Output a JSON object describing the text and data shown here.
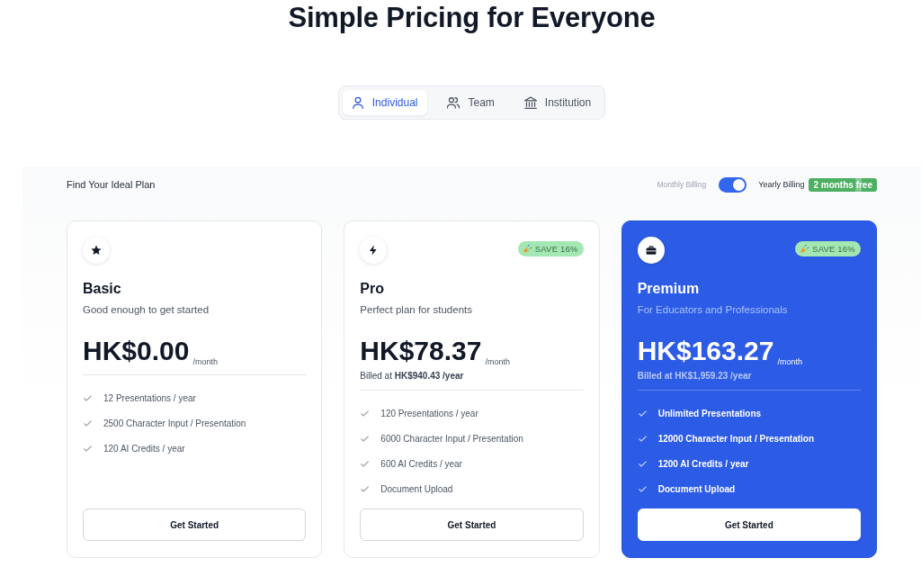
{
  "title": "Simple Pricing for Everyone",
  "audience_tabs": [
    {
      "label": "Individual",
      "selected": true
    },
    {
      "label": "Team",
      "selected": false
    },
    {
      "label": "Institution",
      "selected": false
    }
  ],
  "section_heading": "Find Your Ideal Plan",
  "billing": {
    "monthly_label": "Monthly Billing",
    "yearly_label": "Yearly Billing",
    "yearly": true,
    "promo": "2 months free"
  },
  "plans": [
    {
      "name": "Basic",
      "description": "Good enough to get started",
      "price": "HK$0.00",
      "period": "/month",
      "highlighted": false,
      "features": [
        "12 Presentations / year",
        "2500 Character Input / Presentation",
        "120 AI Credits / year"
      ],
      "button": "Get Started"
    },
    {
      "name": "Pro",
      "badge": "SAVE 16%",
      "description": "Perfect plan for students",
      "price": "HK$78.37",
      "period": "/month",
      "billed": "Billed at **HK$940.43 /year**",
      "highlighted": false,
      "features": [
        "120 Presentations / year",
        "6000 Character Input / Presentation",
        "600 AI Credits / year",
        "Document Upload"
      ],
      "button": "Get Started"
    },
    {
      "name": "Premium",
      "badge": "SAVE 16%",
      "description": "For Educators and Professionals",
      "price": "HK$163.27",
      "period": "/month",
      "billed": "Billed at **HK$1,959.23 /year**",
      "highlighted": true,
      "features": [
        "Unlimited Presentations",
        "12000 Character Input / Presentation",
        "1200 AI Credits / year",
        "Document Upload"
      ],
      "button": "Get Started"
    }
  ]
}
